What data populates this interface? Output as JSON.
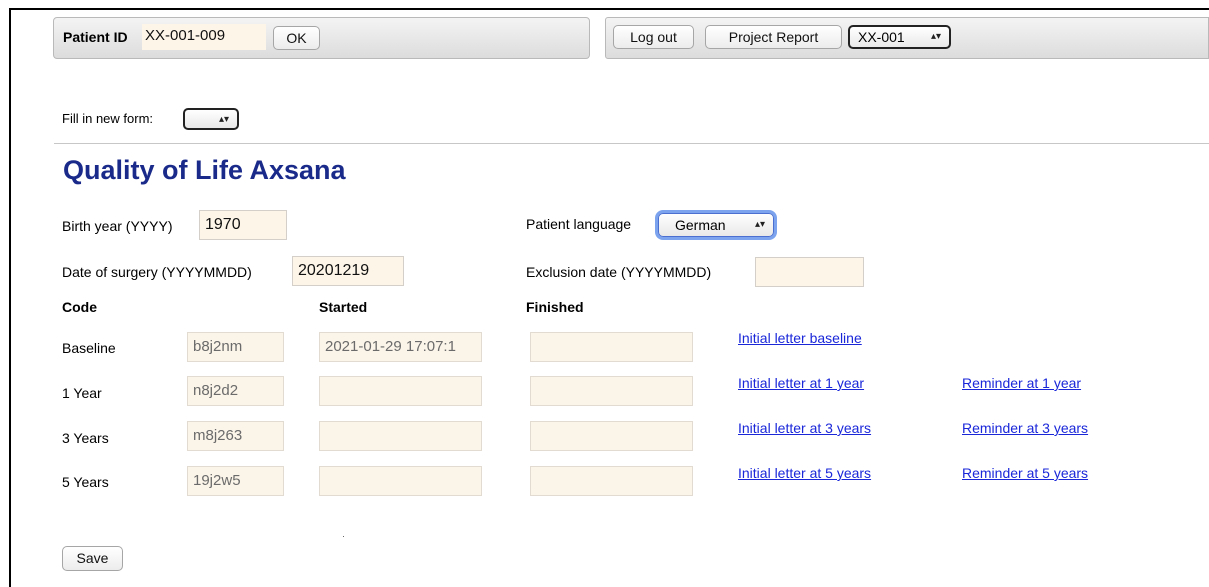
{
  "patient_bar": {
    "label": "Patient ID",
    "value": "XX-001-009",
    "ok_label": "OK"
  },
  "top_bar": {
    "logout_label": "Log out",
    "report_label": "Project Report",
    "project_select": "XX-001"
  },
  "new_form": {
    "label": "Fill in new form:",
    "selected": ""
  },
  "page_title": "Quality of Life Axsana",
  "form": {
    "birth_year_label": "Birth year (YYYY)",
    "birth_year": "1970",
    "language_label": "Patient language",
    "language": "German",
    "surgery_label": "Date of surgery (YYYYMMDD)",
    "surgery_date": "20201219",
    "exclusion_label": "Exclusion date (YYYYMMDD)",
    "exclusion_date": ""
  },
  "table": {
    "headers": {
      "code": "Code",
      "started": "Started",
      "finished": "Finished"
    },
    "rows": [
      {
        "label": "Baseline",
        "code": "b8j2nm",
        "started": "2021-01-29 17:07:1",
        "finished": "",
        "letter": "Initial letter baseline",
        "reminder": ""
      },
      {
        "label": "1 Year",
        "code": "n8j2d2",
        "started": "",
        "finished": "",
        "letter": "Initial letter at 1 year",
        "reminder": "Reminder at 1 year"
      },
      {
        "label": "3 Years",
        "code": "m8j263",
        "started": "",
        "finished": "",
        "letter": "Initial letter at 3 years",
        "reminder": "Reminder at 3 years"
      },
      {
        "label": "5 Years",
        "code": "19j2w5",
        "started": "",
        "finished": "",
        "letter": "Initial letter at 5 years",
        "reminder": "Reminder at 5 years"
      }
    ]
  },
  "save_label": "Save",
  "icons": {
    "select_arrows": "▴▾"
  },
  "colors": {
    "title": "#1a2a8a",
    "link": "#1a27d9",
    "field_bg": "#fdf5e8"
  }
}
